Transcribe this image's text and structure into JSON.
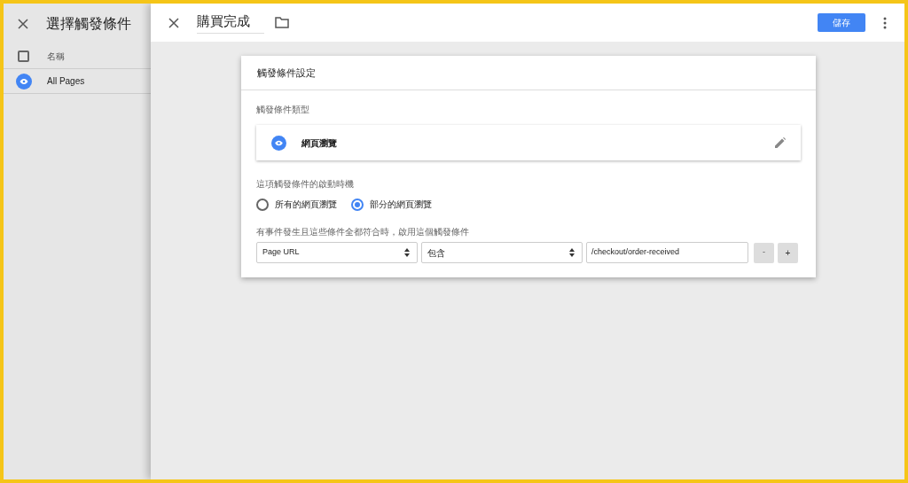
{
  "sidebar": {
    "title": "選擇觸發條件",
    "header": {
      "label": "名稱",
      "checked": false
    },
    "items": [
      {
        "label": "All Pages"
      }
    ]
  },
  "editor": {
    "title": "購買完成",
    "save_button": "儲存"
  },
  "card": {
    "title": "觸發條件設定",
    "type_label": "觸發條件類型",
    "type_name": "網頁瀏覽",
    "timing_label": "這項觸發條件的啟動時機",
    "options": [
      {
        "label": "所有的網頁瀏覽",
        "selected": false
      },
      {
        "label": "部分的網頁瀏覽",
        "selected": true
      }
    ],
    "condition_label": "有事件發生且這些條件全都符合時，啟用這個觸發條件",
    "condition": {
      "variable": "Page URL",
      "operator": "包含",
      "value": "/checkout/order-received",
      "remove": "-",
      "add": "+"
    }
  }
}
